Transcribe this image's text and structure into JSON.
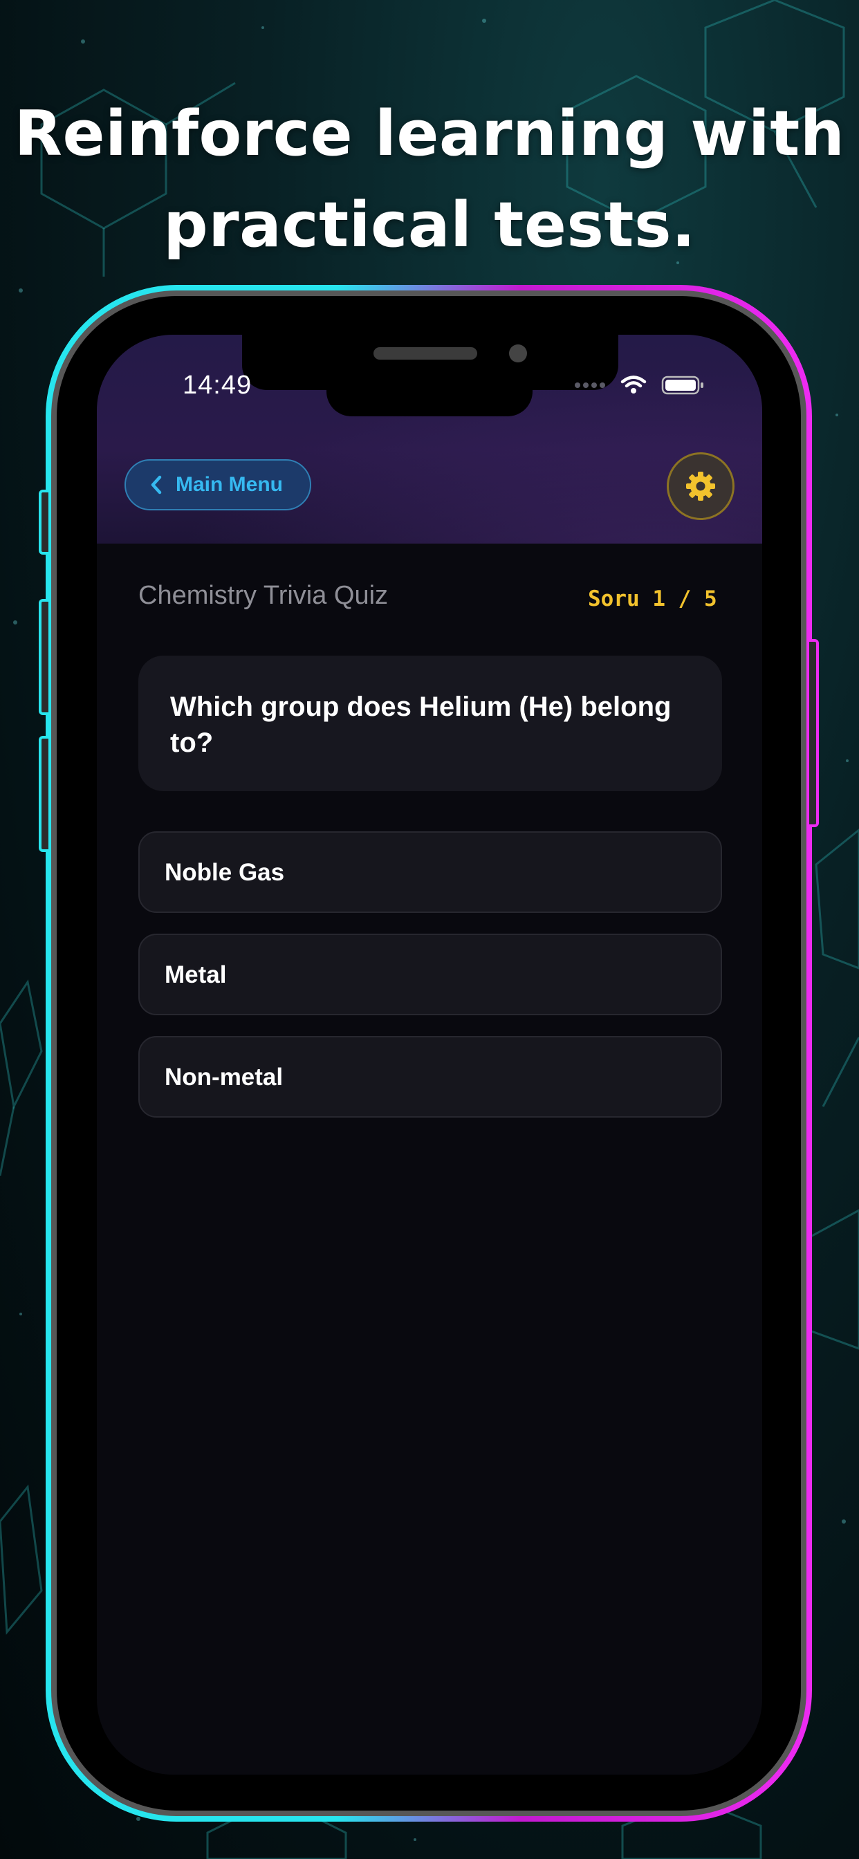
{
  "headline": {
    "line1": "Reinforce learning with",
    "line2": "practical tests."
  },
  "status_bar": {
    "time": "14:49",
    "icons": [
      "signal-dots-icon",
      "wifi-icon",
      "battery-icon"
    ]
  },
  "nav": {
    "back_label": "Main Menu",
    "back_icon": "chevron-left-icon",
    "settings_icon": "gear-icon"
  },
  "quiz": {
    "title": "Chemistry Trivia Quiz",
    "progress": "Soru 1 / 5",
    "question": "Which group does Helium (He) belong to?",
    "options": [
      "Noble Gas",
      "Metal",
      "Non-metal"
    ]
  },
  "colors": {
    "accent_blue": "#36b9f0",
    "accent_yellow": "#f2c22d",
    "frame_cyan": "#27e5ee",
    "frame_magenta": "#ee2bf2"
  }
}
